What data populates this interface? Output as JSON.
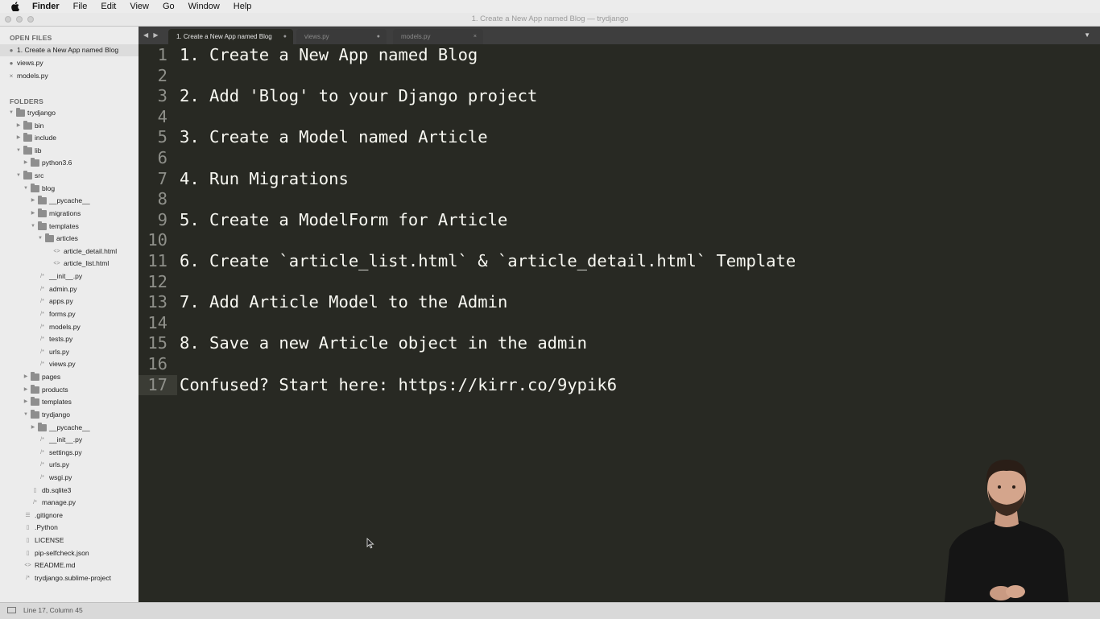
{
  "menubar": {
    "app": "Finder",
    "items": [
      "File",
      "Edit",
      "View",
      "Go",
      "Window",
      "Help"
    ]
  },
  "window": {
    "title": "1. Create a New App named Blog — trydjango"
  },
  "sidebar": {
    "open_files_header": "OPEN FILES",
    "open_files": [
      {
        "name": "1. Create a New App named Blog",
        "mark": "●",
        "active": true
      },
      {
        "name": "views.py",
        "mark": "●",
        "active": false
      },
      {
        "name": "models.py",
        "mark": "×",
        "active": false
      }
    ],
    "folders_header": "FOLDERS",
    "tree": [
      {
        "name": "trydjango",
        "type": "folder",
        "depth": 0,
        "open": true
      },
      {
        "name": "bin",
        "type": "folder",
        "depth": 1,
        "open": false
      },
      {
        "name": "include",
        "type": "folder",
        "depth": 1,
        "open": false
      },
      {
        "name": "lib",
        "type": "folder",
        "depth": 1,
        "open": true
      },
      {
        "name": "python3.6",
        "type": "folder",
        "depth": 2,
        "open": false
      },
      {
        "name": "src",
        "type": "folder",
        "depth": 1,
        "open": true
      },
      {
        "name": "blog",
        "type": "folder",
        "depth": 2,
        "open": true
      },
      {
        "name": "__pycache__",
        "type": "folder",
        "depth": 3,
        "open": false
      },
      {
        "name": "migrations",
        "type": "folder",
        "depth": 3,
        "open": false
      },
      {
        "name": "templates",
        "type": "folder",
        "depth": 3,
        "open": true
      },
      {
        "name": "articles",
        "type": "folder",
        "depth": 4,
        "open": true
      },
      {
        "name": "article_detail.html",
        "type": "file",
        "glyph": "<>",
        "depth": 5
      },
      {
        "name": "article_list.html",
        "type": "file",
        "glyph": "<>",
        "depth": 5
      },
      {
        "name": "__init__.py",
        "type": "file",
        "glyph": "/*",
        "depth": 3
      },
      {
        "name": "admin.py",
        "type": "file",
        "glyph": "/*",
        "depth": 3
      },
      {
        "name": "apps.py",
        "type": "file",
        "glyph": "/*",
        "depth": 3
      },
      {
        "name": "forms.py",
        "type": "file",
        "glyph": "/*",
        "depth": 3
      },
      {
        "name": "models.py",
        "type": "file",
        "glyph": "/*",
        "depth": 3
      },
      {
        "name": "tests.py",
        "type": "file",
        "glyph": "/*",
        "depth": 3
      },
      {
        "name": "urls.py",
        "type": "file",
        "glyph": "/*",
        "depth": 3
      },
      {
        "name": "views.py",
        "type": "file",
        "glyph": "/*",
        "depth": 3
      },
      {
        "name": "pages",
        "type": "folder",
        "depth": 2,
        "open": false
      },
      {
        "name": "products",
        "type": "folder",
        "depth": 2,
        "open": false
      },
      {
        "name": "templates",
        "type": "folder",
        "depth": 2,
        "open": false
      },
      {
        "name": "trydjango",
        "type": "folder",
        "depth": 2,
        "open": true
      },
      {
        "name": "__pycache__",
        "type": "folder",
        "depth": 3,
        "open": false
      },
      {
        "name": "__init__.py",
        "type": "file",
        "glyph": "/*",
        "depth": 3
      },
      {
        "name": "settings.py",
        "type": "file",
        "glyph": "/*",
        "depth": 3
      },
      {
        "name": "urls.py",
        "type": "file",
        "glyph": "/*",
        "depth": 3
      },
      {
        "name": "wsgi.py",
        "type": "file",
        "glyph": "/*",
        "depth": 3
      },
      {
        "name": "db.sqlite3",
        "type": "file",
        "glyph": "▯",
        "depth": 2
      },
      {
        "name": "manage.py",
        "type": "file",
        "glyph": "/*",
        "depth": 2
      },
      {
        "name": ".gitignore",
        "type": "file",
        "glyph": "☰",
        "depth": 1
      },
      {
        "name": ".Python",
        "type": "file",
        "glyph": "▯",
        "depth": 1
      },
      {
        "name": "LICENSE",
        "type": "file",
        "glyph": "▯",
        "depth": 1
      },
      {
        "name": "pip-selfcheck.json",
        "type": "file",
        "glyph": "▯",
        "depth": 1
      },
      {
        "name": "README.md",
        "type": "file",
        "glyph": "<>",
        "depth": 1
      },
      {
        "name": "trydjango.sublime-project",
        "type": "file",
        "glyph": "/*",
        "depth": 1
      }
    ]
  },
  "tabs": [
    {
      "label": "1. Create a New App named Blog",
      "close": "●",
      "active": true
    },
    {
      "label": "views.py",
      "close": "●",
      "active": false
    },
    {
      "label": "models.py",
      "close": "×",
      "active": false
    }
  ],
  "tab_nav": "◀ ▶",
  "tab_dropdown": "▼",
  "editor": {
    "current_line": 17,
    "lines": [
      "1. Create a New App named Blog",
      "",
      "2. Add 'Blog' to your Django project",
      "",
      "3. Create a Model named Article",
      "",
      "4. Run Migrations",
      "",
      "5. Create a ModelForm for Article",
      "",
      "6. Create `article_list.html` & `article_detail.html` Template",
      "",
      "7. Add Article Model to the Admin",
      "",
      "8. Save a new Article object in the admin",
      "",
      "Confused? Start here: https://kirr.co/9ypik6"
    ]
  },
  "statusbar": {
    "position": "Line 17, Column 45"
  },
  "colors": {
    "editor_bg": "#282923",
    "editor_text": "#f8f8f2",
    "gutter_text": "#8f908a",
    "sidebar_bg": "#ececec",
    "tabbar_bg": "#3e3e3e"
  }
}
